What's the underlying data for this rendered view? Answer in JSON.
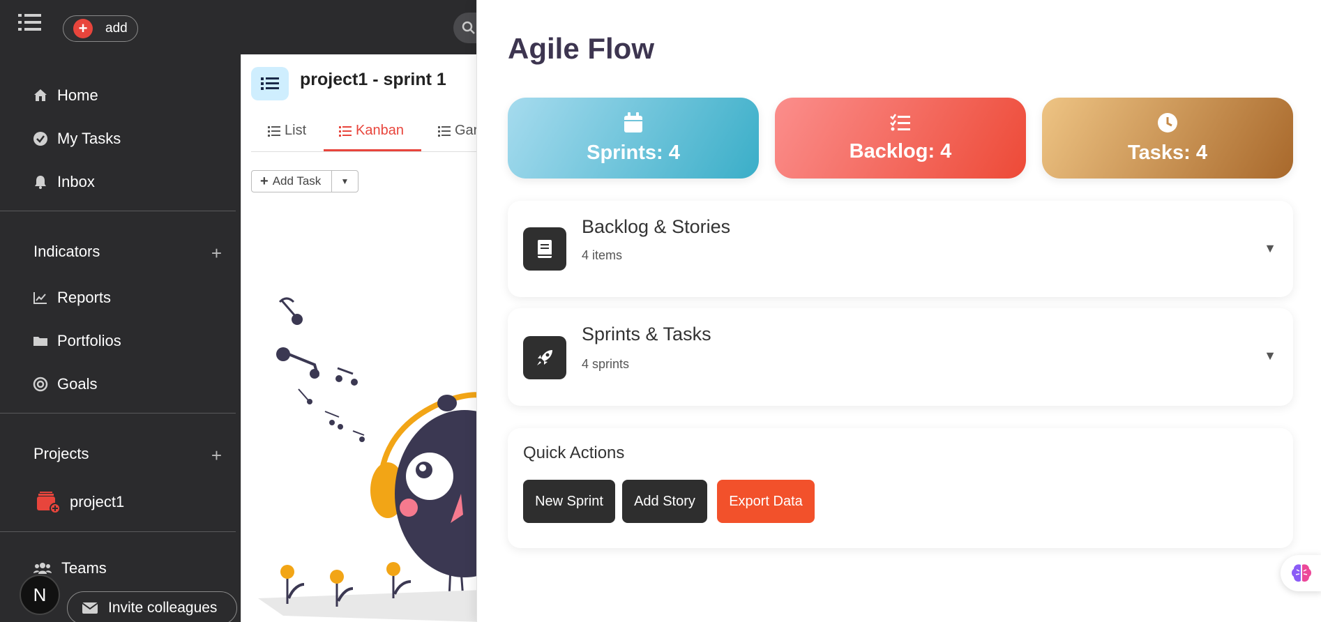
{
  "topbar": {
    "add_label": "add"
  },
  "sidebar": {
    "items": [
      {
        "label": "Home",
        "icon": "home-icon"
      },
      {
        "label": "My Tasks",
        "icon": "check-circle-icon"
      },
      {
        "label": "Inbox",
        "icon": "bell-icon"
      }
    ],
    "indicators": {
      "title": "Indicators",
      "items": [
        {
          "label": "Reports",
          "icon": "chart-line-icon"
        },
        {
          "label": "Portfolios",
          "icon": "folder-icon"
        },
        {
          "label": "Goals",
          "icon": "target-icon"
        }
      ]
    },
    "projects": {
      "title": "Projects",
      "items": [
        {
          "label": "project1",
          "icon": "project-stack-icon"
        }
      ]
    },
    "teams_label": "Teams",
    "avatar_initial": "N",
    "invite_label": "Invite colleagues"
  },
  "project": {
    "title": "project1 - sprint 1",
    "tabs": [
      {
        "label": "List"
      },
      {
        "label": "Kanban",
        "active": true
      },
      {
        "label": "Gar"
      }
    ],
    "add_task_label": "Add Task"
  },
  "panel": {
    "title": "Agile Flow",
    "stats": [
      {
        "label": "Sprints: 4",
        "icon": "calendar-icon"
      },
      {
        "label": "Backlog: 4",
        "icon": "list-check-icon"
      },
      {
        "label": "Tasks: 4",
        "icon": "clock-icon"
      }
    ],
    "sections": [
      {
        "title": "Backlog & Stories",
        "subtitle": "4 items",
        "icon": "book-icon"
      },
      {
        "title": "Sprints & Tasks",
        "subtitle": "4 sprints",
        "icon": "rocket-icon"
      }
    ],
    "quick_actions": {
      "title": "Quick Actions",
      "buttons": [
        {
          "label": "New Sprint"
        },
        {
          "label": "Add Story"
        },
        {
          "label": "Export Data"
        }
      ]
    }
  },
  "colors": {
    "sidebar_bg": "#2b2b2d",
    "accent_red": "#e8453c",
    "export_orange": "#f2512b",
    "title_purple": "#3d3550"
  }
}
